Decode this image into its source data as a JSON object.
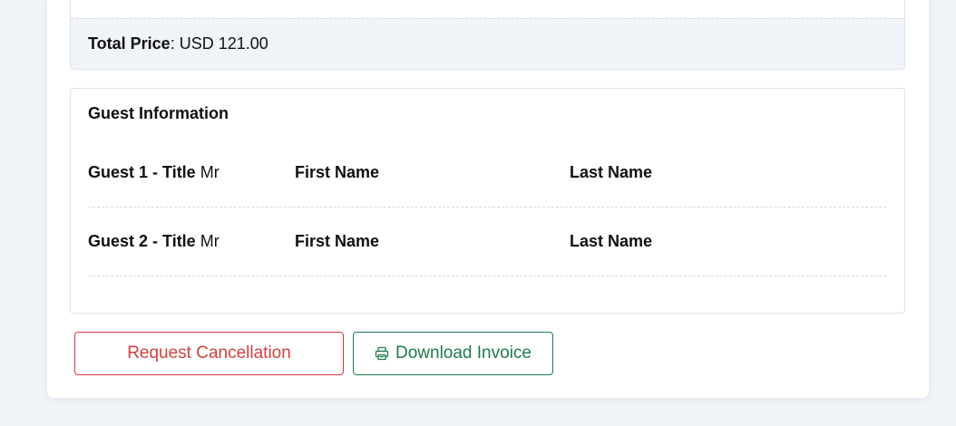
{
  "price": {
    "label": "Total Price",
    "separator": ":",
    "value": "USD 121.00"
  },
  "guests": {
    "heading": "Guest Information",
    "rows": [
      {
        "title_label": "Guest 1 - Title",
        "title_value": "Mr",
        "first_name_label": "First Name",
        "last_name_label": "Last Name"
      },
      {
        "title_label": "Guest 2 - Title",
        "title_value": "Mr",
        "first_name_label": "First Name",
        "last_name_label": "Last Name"
      }
    ]
  },
  "actions": {
    "cancel_label": "Request Cancellation",
    "invoice_label": "Download Invoice",
    "invoice_icon": "printer-icon"
  },
  "colors": {
    "danger": "#d23f3f",
    "success": "#1f7a4c",
    "page_background": "#f0f3f8"
  }
}
